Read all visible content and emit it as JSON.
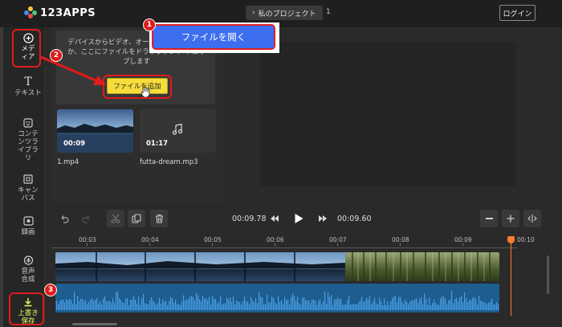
{
  "app": {
    "logo_text": "123APPS"
  },
  "header": {
    "back_label": "私のプロジェクト",
    "project_count": "1",
    "login_label": "ログイン"
  },
  "sidebar": {
    "items": [
      {
        "label": "メディア",
        "icon": "plus-circle-icon"
      },
      {
        "label": "テキスト",
        "icon": "text-icon"
      },
      {
        "label": "コンテンツライブラリ",
        "icon": "library-icon"
      },
      {
        "label": "キャンバス",
        "icon": "canvas-icon"
      },
      {
        "label": "録画",
        "icon": "record-icon"
      },
      {
        "label": "音声合成",
        "icon": "speech-icon"
      },
      {
        "label": "上書き保存",
        "icon": "download-icon"
      }
    ]
  },
  "media": {
    "drop_text": "デバイスからビデオ、オーディオ を追加するか、ここにファイルをドラッグアンド ドロップします",
    "add_file_label": "ファイルを追加",
    "files": [
      {
        "name": "1.mp4",
        "duration": "00:09",
        "kind": "video"
      },
      {
        "name": "futta-dream.mp3",
        "duration": "01:17",
        "kind": "audio"
      }
    ]
  },
  "transport": {
    "current_time": "00:09.78",
    "total_time": "00:09.60"
  },
  "timeline": {
    "ticks": [
      "00:03",
      "00:04",
      "00:05",
      "00:06",
      "00:07",
      "00:08",
      "00:09",
      "00:10"
    ]
  },
  "annotations": {
    "open_file_label": "ファイルを開く",
    "badges": [
      "1",
      "2",
      "3"
    ]
  },
  "colors": {
    "accent": "#3d6ef0",
    "add_button": "#f6dd3c",
    "playhead": "#ff7a2e",
    "annotation": "#e21b1b",
    "audio_track": "#1e5d8f"
  }
}
